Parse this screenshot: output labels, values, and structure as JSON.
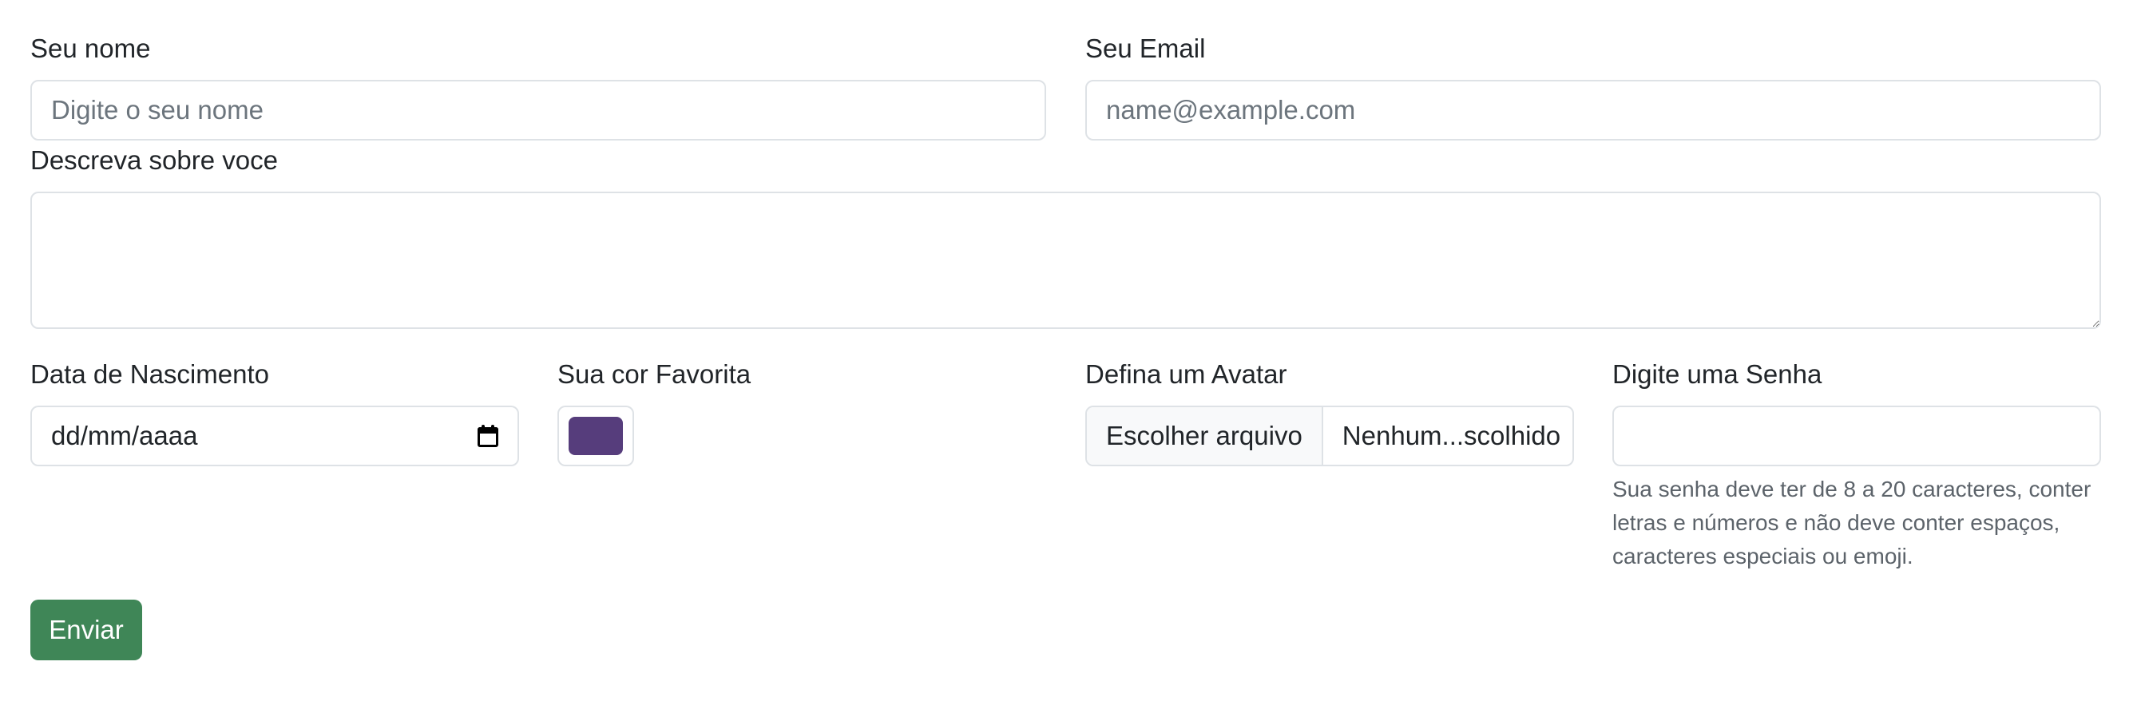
{
  "form": {
    "name": {
      "label": "Seu nome",
      "placeholder": "Digite o seu nome",
      "value": ""
    },
    "email": {
      "label": "Seu Email",
      "placeholder": "name@example.com",
      "value": ""
    },
    "about": {
      "label": "Descreva sobre voce",
      "value": ""
    },
    "birthdate": {
      "label": "Data de Nascimento",
      "display": "dd/mm/aaaa",
      "icon": "calendar-icon"
    },
    "favorite_color": {
      "label": "Sua cor Favorita",
      "value": "#563d7c"
    },
    "avatar": {
      "label": "Defina um Avatar",
      "button_label": "Escolher arquivo",
      "file_status": "Nenhum...scolhido"
    },
    "password": {
      "label": "Digite uma Senha",
      "value": "",
      "help": "Sua senha deve ter de 8 a 20 caracteres, conter letras e números e não deve conter espaços, caracteres especiais ou emoji."
    },
    "submit_label": "Enviar"
  },
  "colors": {
    "submit_bg": "#3f8657",
    "border": "#dee2e6",
    "placeholder": "#6c757d",
    "help_text": "#5c636a"
  }
}
